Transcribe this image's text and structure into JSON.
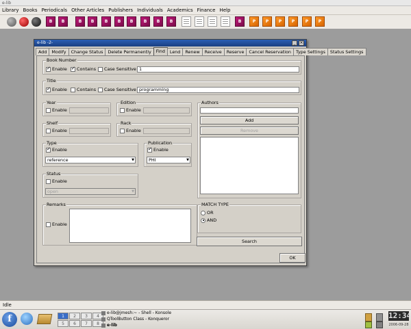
{
  "app": {
    "title": "e-lib",
    "menu": [
      "Library",
      "Books",
      "Periodicals",
      "Other Articles",
      "Publishers",
      "Individuals",
      "Academics",
      "Finance",
      "Help"
    ],
    "status": "Idle",
    "toolbar_labels": {
      "b": "B",
      "p": "P"
    }
  },
  "dialog": {
    "title": "e-lib -2-",
    "tabs": [
      "Add",
      "Modify",
      "Change Status",
      "Delete Permanently",
      "Find",
      "Lend",
      "Renew",
      "Receive",
      "Reserve",
      "Cancel Reservation",
      "Type Settings",
      "Status Settings"
    ],
    "active_tab": "Find",
    "book_number": {
      "title": "Book Number",
      "enable_label": "Enable",
      "enable": true,
      "contains_label": "Contains",
      "contains": true,
      "case_label": "Case Sensitive",
      "case": false,
      "value": "1"
    },
    "title_group": {
      "title": "Title",
      "enable_label": "Enable",
      "enable": true,
      "contains_label": "Contains",
      "contains": false,
      "case_label": "Case Sensitive",
      "case": false,
      "value": "programming"
    },
    "year": {
      "title": "Year",
      "enable_label": "Enable",
      "value": ""
    },
    "edition": {
      "title": "Edition",
      "enable_label": "Enable",
      "value": ""
    },
    "shelf": {
      "title": "Shelf",
      "enable_label": "Enable",
      "value": ""
    },
    "rack": {
      "title": "Rack",
      "enable_label": "Enable",
      "value": ""
    },
    "type": {
      "title": "Type",
      "enable_label": "Enable",
      "enable": true,
      "selected": "reference"
    },
    "publication": {
      "title": "Publication",
      "enable_label": "Enable",
      "enable": true,
      "selected": "PHI"
    },
    "status": {
      "title": "Status",
      "enable_label": "Enable",
      "enable": false,
      "selected": "open"
    },
    "remarks": {
      "title": "Remarks",
      "enable_label": "Enable",
      "value": ""
    },
    "authors": {
      "title": "Authors",
      "input": "",
      "add_label": "Add",
      "remove_label": "Remove"
    },
    "match_type": {
      "title": "MATCH TYPE",
      "or_label": "OR",
      "and_label": "AND",
      "selected": "AND"
    },
    "search_label": "Search",
    "ok_label": "OK"
  },
  "taskbar": {
    "pager": [
      "1",
      "2",
      "3",
      "4",
      "5",
      "6",
      "7",
      "8"
    ],
    "tasks": [
      "e-lib@jmesh:~ - Shell - Konsole",
      "QToolButton Class - Konqueror",
      "e-lib"
    ],
    "clock": "12:34",
    "date": "2006-09-28"
  }
}
